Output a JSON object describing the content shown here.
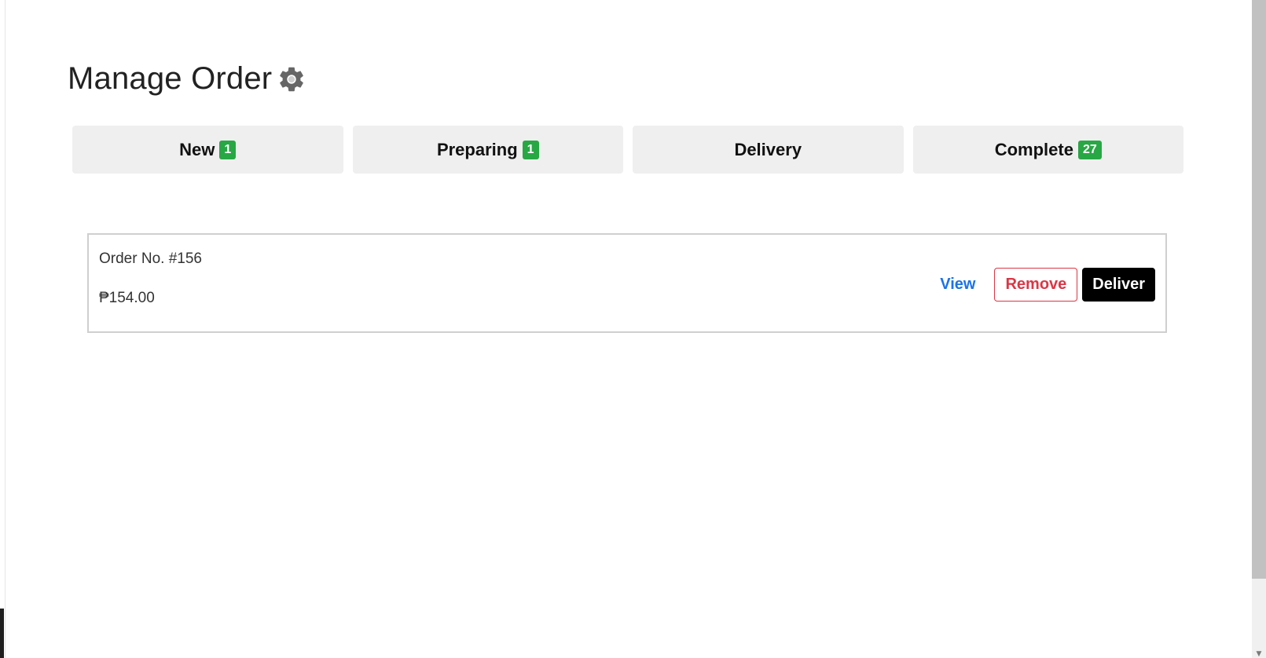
{
  "header": {
    "title": "Manage Order",
    "icon": "gear-icon"
  },
  "tabs": [
    {
      "label": "New",
      "badge": "1"
    },
    {
      "label": "Preparing",
      "badge": "1"
    },
    {
      "label": "Delivery"
    },
    {
      "label": "Complete",
      "badge": "27"
    }
  ],
  "orders": [
    {
      "order_no": "Order No. #156",
      "total": "₱154.00",
      "actions": {
        "view": "View",
        "remove": "Remove",
        "deliver": "Deliver"
      }
    }
  ],
  "colors": {
    "badge": "#28a745",
    "view_link": "#1a73e8",
    "remove": "#dc3545",
    "deliver_bg": "#000000",
    "tab_bg": "#efefef"
  }
}
